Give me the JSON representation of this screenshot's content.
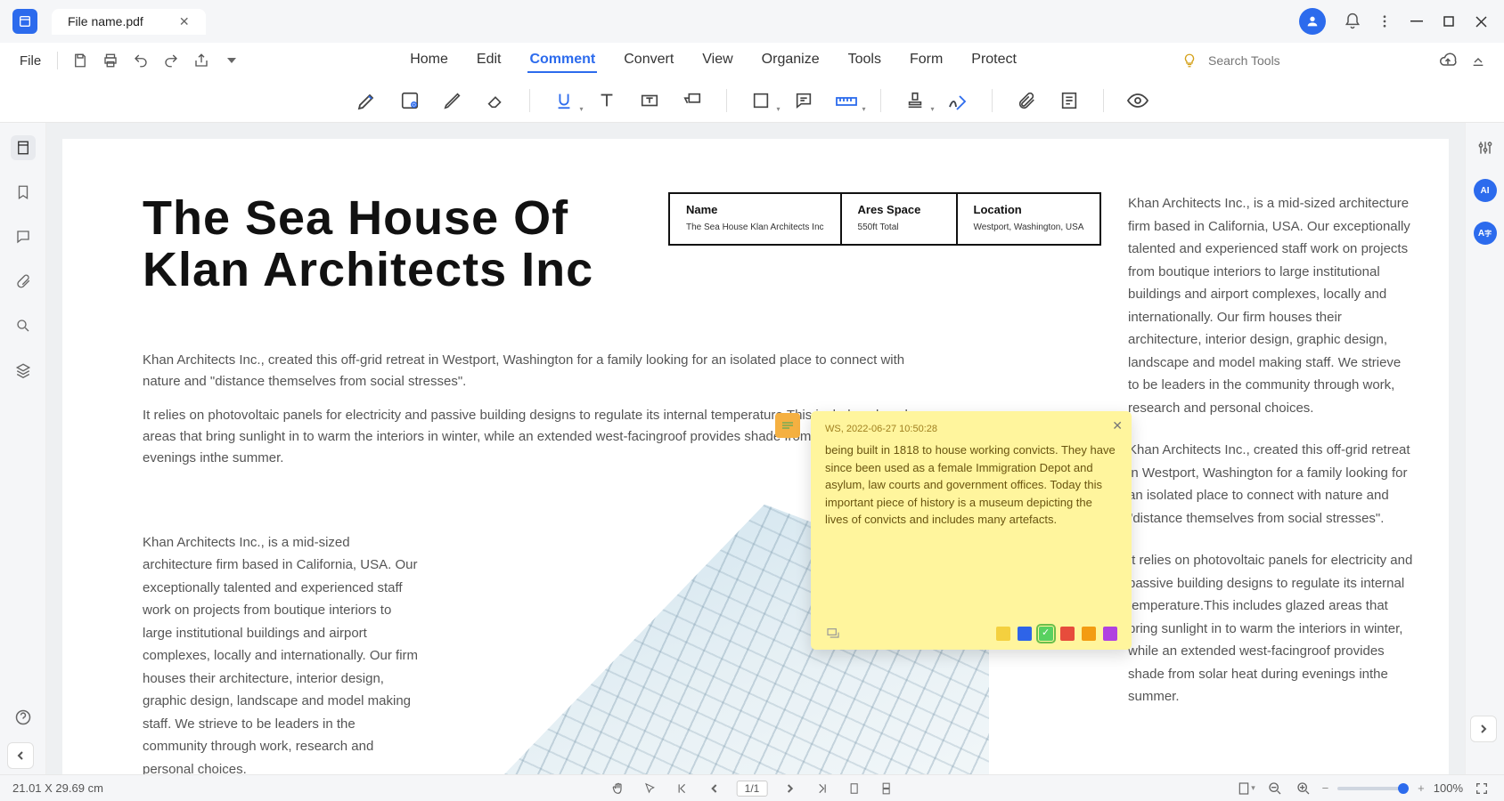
{
  "tab": {
    "filename": "File name.pdf"
  },
  "menu": {
    "file": "File",
    "tabs": [
      "Home",
      "Edit",
      "Comment",
      "Convert",
      "View",
      "Organize",
      "Tools",
      "Form",
      "Protect"
    ],
    "active": "Comment"
  },
  "search": {
    "placeholder": "Search Tools"
  },
  "document": {
    "title_line1": "The Sea House Of",
    "title_line2": "Klan Architects Inc",
    "info": [
      {
        "header": "Name",
        "value": "The Sea House Klan Architects Inc"
      },
      {
        "header": "Ares Space",
        "value": "550ft Total"
      },
      {
        "header": "Location",
        "value": "Westport, Washington, USA"
      }
    ],
    "para1": "Khan Architects Inc., created this off-grid retreat in Westport, Washington for a family looking for an isolated place to connect with nature and \"distance themselves from social stresses\".",
    "para2": "It relies on photovoltaic panels for electricity and passive building designs to regulate its internal temperature.This includes glazed areas that bring sunlight in to warm the interiors in winter, while an extended west-facingroof provides shade from solar heat during evenings inthe summer.",
    "col_left": "Khan Architects Inc., is a mid-sized architecture firm based in California, USA. Our exceptionally talented and experienced staff work on projects from boutique interiors to large institutional buildings and airport complexes, locally and internationally. Our firm houses their architecture, interior design, graphic design, landscape and model making staff. We strieve to be leaders in the community through work, research and personal choices.",
    "right_p1": "Khan Architects Inc., is a mid-sized architecture firm based in California, USA. Our exceptionally talented and experienced staff work on projects from boutique interiors to large institutional buildings and airport complexes, locally and internationally. Our firm houses their architecture, interior design, graphic design, landscape and model making staff. We strieve to be leaders in the community through work, research and personal choices.",
    "right_p2": "Khan Architects Inc., created this off-grid retreat in Westport, Washington for a family looking for an isolated place to connect with nature and \"distance themselves from social stresses\".",
    "right_p3": "It relies on photovoltaic panels for electricity and passive building designs to regulate its internal temperature.This includes glazed areas that bring sunlight in to warm the interiors in winter, while an extended west-facingroof provides shade from solar heat during evenings inthe summer."
  },
  "note": {
    "author": "WS",
    "timestamp": "2022-06-27 10:50:28",
    "body": "being built in 1818 to house working convicts. They have since been used as a female Immigration Depot and asylum, law courts and government offices. Today this important piece of history is a museum depicting the lives of convicts and includes many artefacts.",
    "swatches": [
      "#f4d03f",
      "#2e64e8",
      "#58d160",
      "#e74c3c",
      "#f39c12",
      "#b042e0"
    ],
    "selected_swatch": 2
  },
  "status": {
    "dims": "21.01 X 29.69 cm",
    "page": "1/1",
    "zoom": "100%"
  }
}
